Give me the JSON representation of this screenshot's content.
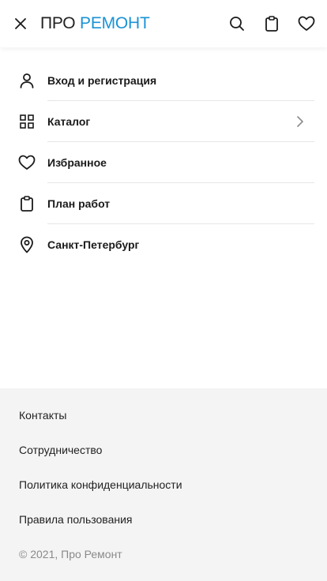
{
  "header": {
    "logo_part1": "ПРО",
    "logo_part2": "РЕМОНТ",
    "icons": [
      "close-icon",
      "search-icon",
      "clipboard-icon",
      "heart-icon"
    ]
  },
  "menu": {
    "items": [
      {
        "label": "Вход и регистрация",
        "icon": "user-icon"
      },
      {
        "label": "Каталог",
        "icon": "grid-icon",
        "has_chevron": true
      },
      {
        "label": "Избранное",
        "icon": "heart-icon"
      },
      {
        "label": "План работ",
        "icon": "clipboard-icon"
      },
      {
        "label": "Санкт-Петербург",
        "icon": "location-pin-icon"
      }
    ]
  },
  "footer": {
    "links": [
      "Контакты",
      "Сотрудничество",
      "Политика конфиденциальности",
      "Правила пользования"
    ],
    "copyright": "© 2021, Про Ремонт"
  },
  "colors": {
    "accent": "#1a93d6",
    "footer_bg": "#f4f4f4",
    "text": "#1a1a1a",
    "muted": "#8a8a8a"
  }
}
